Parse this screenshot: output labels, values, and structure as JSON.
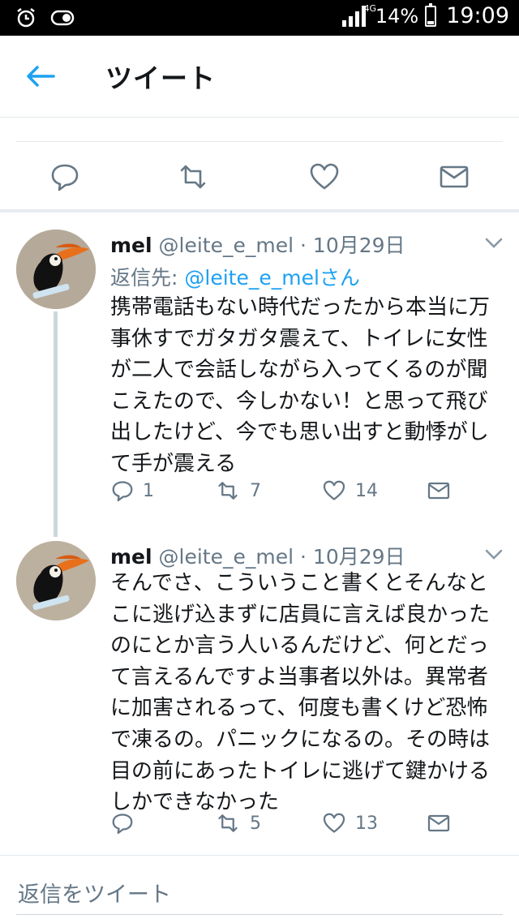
{
  "status_bar": {
    "network": "4G",
    "battery": "14%",
    "time": "19:09"
  },
  "header": {
    "title": "ツイート"
  },
  "tweets": [
    {
      "name": "mel",
      "handle": "@leite_e_mel",
      "separator": "·",
      "date": "10月29日",
      "reply_label": "返信先:",
      "reply_to": "@leite_e_melさん",
      "lines": [
        "携帯電話もない時代だったから本当に万",
        "事休すでガタガタ震えて、トイレに女性",
        "が二人で会話しながら入ってくるのが聞",
        "こえたので、今しかない！と思って飛び",
        "出したけど、今でも思い出すと動悸がし",
        "て手が震える"
      ],
      "replies": "1",
      "retweets": "7",
      "likes": "14"
    },
    {
      "name": "mel",
      "handle": "@leite_e_mel",
      "separator": "·",
      "date": "10月29日",
      "lines": [
        "そんでさ、こういうこと書くとそんなと",
        "こに逃げ込まずに店員に言えば良かった",
        "のにとか言う人いるんだけど、何とだっ",
        "て言えるんですよ当事者以外は。異常者",
        "に加害されるって、何度も書くけど恐怖",
        "で凍るの。パニックになるの。その時は",
        "目の前にあったトイレに逃げて鍵かける",
        "しかできなかった"
      ],
      "replies": "",
      "retweets": "5",
      "likes": "13"
    }
  ],
  "reply_bar": {
    "placeholder": "返信をツイート"
  },
  "colors": {
    "accent": "#1da1f2",
    "muted": "#657786",
    "text": "#14171a",
    "border": "#e1e8ed"
  }
}
